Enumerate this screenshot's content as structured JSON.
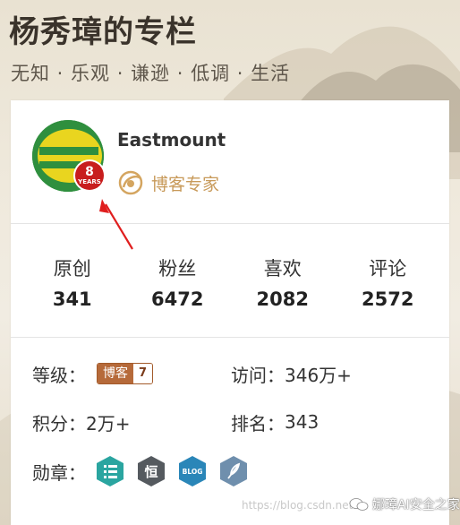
{
  "header": {
    "title": "杨秀璋的专栏",
    "subtitle": "无知 · 乐观 · 谦逊 · 低调 · 生活"
  },
  "profile": {
    "username": "Eastmount",
    "badge_years": "8",
    "badge_years_label": "YEARS",
    "expert_label": "博客专家"
  },
  "stats": [
    {
      "label": "原创",
      "value": "341"
    },
    {
      "label": "粉丝",
      "value": "6472"
    },
    {
      "label": "喜欢",
      "value": "2082"
    },
    {
      "label": "评论",
      "value": "2572"
    }
  ],
  "info": {
    "level_label": "等级：",
    "level_badge_text": "博客",
    "level_badge_num": "7",
    "visits_label": "访问：",
    "visits_value": "346万+",
    "points_label": "积分：",
    "points_value": "2万+",
    "rank_label": "排名：",
    "rank_value": "343",
    "medals_label": "勋章："
  },
  "medals": [
    {
      "icon": "list-icon",
      "color": "#2aa5a0",
      "text": ""
    },
    {
      "icon": "heng-icon",
      "color": "#555a5f",
      "text": "恒"
    },
    {
      "icon": "blog-icon",
      "color": "#2a86b8",
      "text": "BLOG"
    },
    {
      "icon": "feather-icon",
      "color": "#6f8fad",
      "text": ""
    }
  ],
  "watermark": {
    "url": "https://blog.csdn.net",
    "brand": "娜璋AI安全之家"
  },
  "colors": {
    "badge_red": "#c81d1d",
    "expert_gold": "#c89a5a",
    "annotation_red": "#e01e1e"
  }
}
